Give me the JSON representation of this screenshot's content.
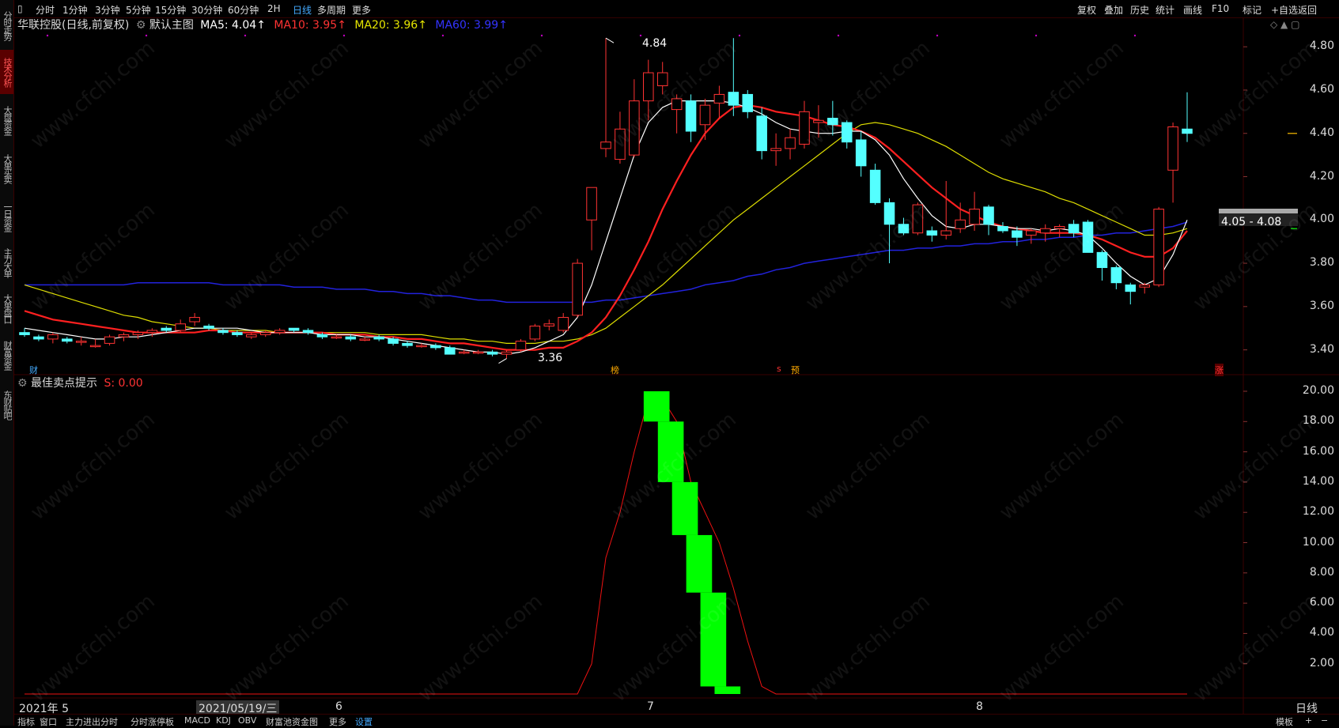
{
  "sidebar": {
    "tabs": [
      {
        "label": "分时走势",
        "active": false
      },
      {
        "label": "技术分析",
        "active": true
      },
      {
        "label": "大盘资金",
        "active": false
      },
      {
        "label": "大单买卖",
        "active": false
      },
      {
        "label": "一日资金",
        "active": false
      },
      {
        "label": "主力大单",
        "active": false
      },
      {
        "label": "大单盘口",
        "active": false
      },
      {
        "label": "财富资金",
        "active": false
      },
      {
        "label": "东财贴吧",
        "active": false
      }
    ]
  },
  "toolbar": {
    "periods": [
      "分时",
      "1分钟",
      "3分钟",
      "5分钟",
      "15分钟",
      "30分钟",
      "60分钟",
      "2H",
      "日线",
      "多周期",
      "更多"
    ],
    "active_period": "日线",
    "right_items": [
      "复权",
      "叠加",
      "历史",
      "统计",
      "画线",
      "F10",
      "标记",
      "+自选",
      "返回"
    ]
  },
  "main_header": {
    "stock": "华联控股(日线,前复权)",
    "chart_name": "默认主图",
    "ma5": "MA5: 4.04↑",
    "ma10": "MA10: 3.95↑",
    "ma20": "MA20: 3.96↑",
    "ma60": "MA60: 3.99↑"
  },
  "indicator_header": {
    "name": "最佳卖点提示",
    "value": "S: 0.00"
  },
  "price_axis": [
    "4.80",
    "4.60",
    "4.40",
    "4.20",
    "4.00",
    "3.80",
    "3.60",
    "3.40"
  ],
  "indicator_axis": [
    "20.00",
    "18.00",
    "16.00",
    "14.00",
    "12.00",
    "10.00",
    "8.00",
    "6.00",
    "4.00",
    "2.00"
  ],
  "annotations": {
    "high": "4.84",
    "low": "3.36",
    "current_range": "4.05 - 4.08",
    "marker_cai": "财",
    "marker_bang": "榜",
    "marker_s": "s",
    "marker_yu": "预",
    "marker_zhang": "涨"
  },
  "date_axis": [
    "2021年 5",
    "2021/05/19/三",
    "6",
    "7",
    "8",
    "日线"
  ],
  "bottombar": {
    "items": [
      "指标",
      "窗口",
      "主力进出分时",
      "分时涨停板",
      "MACD",
      "KDJ",
      "OBV",
      "财富池资金图",
      "更多",
      "设置"
    ],
    "active": "设置",
    "right_items": [
      "模板",
      "+",
      "−"
    ]
  },
  "watermark": "www.cfchi.com",
  "colors": {
    "up": "#ff3333",
    "down": "#54ffff",
    "ma5": "#ffffff",
    "ma10": "#ff2020",
    "ma20": "#dddd00",
    "ma60": "#2222dd",
    "signal": "#00ff00",
    "grid": "#3a0000"
  },
  "chart_data": [
    {
      "type": "candlestick",
      "title": "华联控股(日线,前复权)",
      "ylim": [
        3.3,
        4.87
      ],
      "candles": [
        [
          3.48,
          3.5,
          3.46,
          3.47
        ],
        [
          3.46,
          3.47,
          3.44,
          3.45
        ],
        [
          3.45,
          3.48,
          3.43,
          3.47
        ],
        [
          3.45,
          3.46,
          3.43,
          3.44
        ],
        [
          3.44,
          3.46,
          3.42,
          3.44
        ],
        [
          3.42,
          3.45,
          3.41,
          3.42
        ],
        [
          3.43,
          3.47,
          3.42,
          3.46
        ],
        [
          3.46,
          3.48,
          3.44,
          3.47
        ],
        [
          3.47,
          3.49,
          3.45,
          3.48
        ],
        [
          3.48,
          3.5,
          3.46,
          3.49
        ],
        [
          3.5,
          3.51,
          3.48,
          3.49
        ],
        [
          3.49,
          3.54,
          3.48,
          3.52
        ],
        [
          3.53,
          3.57,
          3.51,
          3.55
        ],
        [
          3.51,
          3.52,
          3.49,
          3.5
        ],
        [
          3.49,
          3.5,
          3.47,
          3.48
        ],
        [
          3.48,
          3.49,
          3.46,
          3.47
        ],
        [
          3.46,
          3.48,
          3.45,
          3.47
        ],
        [
          3.47,
          3.49,
          3.46,
          3.48
        ],
        [
          3.48,
          3.5,
          3.47,
          3.49
        ],
        [
          3.5,
          3.5,
          3.48,
          3.49
        ],
        [
          3.49,
          3.5,
          3.47,
          3.48
        ],
        [
          3.47,
          3.48,
          3.45,
          3.46
        ],
        [
          3.46,
          3.47,
          3.45,
          3.46
        ],
        [
          3.46,
          3.47,
          3.44,
          3.45
        ],
        [
          3.45,
          3.46,
          3.44,
          3.45
        ],
        [
          3.46,
          3.47,
          3.44,
          3.45
        ],
        [
          3.45,
          3.46,
          3.42,
          3.43
        ],
        [
          3.43,
          3.44,
          3.41,
          3.42
        ],
        [
          3.42,
          3.43,
          3.41,
          3.42
        ],
        [
          3.42,
          3.43,
          3.4,
          3.41
        ],
        [
          3.41,
          3.42,
          3.38,
          3.38
        ],
        [
          3.39,
          3.4,
          3.38,
          3.39
        ],
        [
          3.39,
          3.4,
          3.38,
          3.39
        ],
        [
          3.39,
          3.4,
          3.37,
          3.38
        ],
        [
          3.38,
          3.4,
          3.36,
          3.39
        ],
        [
          3.4,
          3.45,
          3.39,
          3.44
        ],
        [
          3.45,
          3.52,
          3.44,
          3.51
        ],
        [
          3.51,
          3.54,
          3.49,
          3.52
        ],
        [
          3.49,
          3.57,
          3.48,
          3.55
        ],
        [
          3.56,
          3.82,
          3.55,
          3.8
        ],
        [
          4.0,
          4.08,
          3.86,
          4.15
        ],
        [
          4.33,
          4.84,
          4.29,
          4.36
        ],
        [
          4.28,
          4.5,
          4.26,
          4.42
        ],
        [
          4.3,
          4.65,
          4.29,
          4.55
        ],
        [
          4.55,
          4.74,
          4.46,
          4.68
        ],
        [
          4.62,
          4.73,
          4.58,
          4.68
        ],
        [
          4.51,
          4.58,
          4.4,
          4.56
        ],
        [
          4.55,
          4.58,
          4.36,
          4.41
        ],
        [
          4.44,
          4.56,
          4.37,
          4.53
        ],
        [
          4.54,
          4.62,
          4.47,
          4.58
        ],
        [
          4.59,
          4.84,
          4.48,
          4.53
        ],
        [
          4.58,
          4.6,
          4.47,
          4.5
        ],
        [
          4.48,
          4.52,
          4.28,
          4.32
        ],
        [
          4.32,
          4.4,
          4.25,
          4.33
        ],
        [
          4.33,
          4.42,
          4.28,
          4.38
        ],
        [
          4.35,
          4.55,
          4.33,
          4.5
        ],
        [
          4.45,
          4.53,
          4.38,
          4.46
        ],
        [
          4.47,
          4.55,
          4.39,
          4.44
        ],
        [
          4.45,
          4.46,
          4.33,
          4.36
        ],
        [
          4.37,
          4.41,
          4.2,
          4.25
        ],
        [
          4.23,
          4.26,
          4.07,
          4.08
        ],
        [
          4.08,
          4.1,
          3.8,
          3.98
        ],
        [
          3.98,
          4.01,
          3.93,
          3.94
        ],
        [
          3.94,
          4.08,
          3.93,
          4.07
        ],
        [
          3.95,
          3.97,
          3.9,
          3.93
        ],
        [
          3.93,
          4.18,
          3.91,
          3.95
        ],
        [
          3.96,
          4.08,
          3.94,
          4.0
        ],
        [
          3.98,
          4.13,
          3.95,
          4.05
        ],
        [
          4.06,
          4.07,
          3.93,
          3.98
        ],
        [
          3.97,
          3.99,
          3.94,
          3.95
        ],
        [
          3.95,
          3.97,
          3.88,
          3.92
        ],
        [
          3.93,
          3.96,
          3.89,
          3.95
        ],
        [
          3.94,
          3.98,
          3.9,
          3.96
        ],
        [
          3.96,
          3.98,
          3.92,
          3.97
        ],
        [
          3.98,
          4.0,
          3.92,
          3.94
        ],
        [
          3.99,
          4.0,
          3.85,
          3.85
        ],
        [
          3.85,
          3.86,
          3.72,
          3.78
        ],
        [
          3.78,
          3.79,
          3.68,
          3.71
        ],
        [
          3.7,
          3.71,
          3.61,
          3.67
        ],
        [
          3.69,
          3.71,
          3.66,
          3.7
        ],
        [
          3.7,
          4.06,
          3.69,
          4.05
        ],
        [
          4.23,
          4.45,
          4.08,
          4.43
        ],
        [
          4.42,
          4.59,
          4.36,
          4.4
        ]
      ],
      "ma": [
        {
          "name": "MA5",
          "values": [
            3.5,
            3.49,
            3.48,
            3.47,
            3.46,
            3.45,
            3.45,
            3.46,
            3.46,
            3.47,
            3.48,
            3.49,
            3.5,
            3.5,
            3.5,
            3.5,
            3.49,
            3.48,
            3.48,
            3.48,
            3.48,
            3.47,
            3.47,
            3.47,
            3.46,
            3.46,
            3.45,
            3.44,
            3.43,
            3.42,
            3.41,
            3.4,
            3.39,
            3.39,
            3.38,
            3.39,
            3.41,
            3.44,
            3.47,
            3.55,
            3.7,
            3.9,
            4.1,
            4.3,
            4.45,
            4.52,
            4.55,
            4.55,
            4.55,
            4.55,
            4.54,
            4.52,
            4.49,
            4.45,
            4.42,
            4.41,
            4.4,
            4.4,
            4.41,
            4.41,
            4.37,
            4.3,
            4.19,
            4.1,
            4.02,
            3.97,
            3.96,
            3.98,
            3.98,
            3.97,
            3.96,
            3.96,
            3.95,
            3.96,
            3.95,
            3.93,
            3.87,
            3.8,
            3.74,
            3.7,
            3.73,
            3.84,
            4.0
          ]
        },
        {
          "name": "MA10",
          "values": [
            3.58,
            3.56,
            3.54,
            3.53,
            3.52,
            3.51,
            3.5,
            3.49,
            3.48,
            3.48,
            3.48,
            3.48,
            3.48,
            3.49,
            3.49,
            3.48,
            3.48,
            3.48,
            3.48,
            3.48,
            3.48,
            3.48,
            3.47,
            3.47,
            3.47,
            3.46,
            3.46,
            3.45,
            3.45,
            3.44,
            3.43,
            3.43,
            3.42,
            3.41,
            3.4,
            3.4,
            3.4,
            3.41,
            3.41,
            3.44,
            3.48,
            3.55,
            3.65,
            3.77,
            3.9,
            4.05,
            4.18,
            4.3,
            4.4,
            4.47,
            4.52,
            4.53,
            4.52,
            4.5,
            4.49,
            4.48,
            4.46,
            4.44,
            4.43,
            4.41,
            4.38,
            4.33,
            4.27,
            4.21,
            4.15,
            4.1,
            4.05,
            4.02,
            3.99,
            3.97,
            3.96,
            3.95,
            3.94,
            3.94,
            3.94,
            3.93,
            3.91,
            3.88,
            3.85,
            3.83,
            3.83,
            3.87,
            3.95
          ]
        },
        {
          "name": "MA20",
          "values": [
            3.7,
            3.68,
            3.66,
            3.64,
            3.62,
            3.6,
            3.58,
            3.56,
            3.55,
            3.53,
            3.52,
            3.51,
            3.5,
            3.5,
            3.49,
            3.49,
            3.49,
            3.49,
            3.48,
            3.48,
            3.48,
            3.48,
            3.48,
            3.48,
            3.48,
            3.47,
            3.47,
            3.47,
            3.47,
            3.46,
            3.45,
            3.45,
            3.44,
            3.44,
            3.43,
            3.43,
            3.43,
            3.44,
            3.44,
            3.45,
            3.47,
            3.5,
            3.55,
            3.6,
            3.65,
            3.7,
            3.76,
            3.82,
            3.88,
            3.94,
            4.0,
            4.05,
            4.1,
            4.15,
            4.2,
            4.25,
            4.3,
            4.35,
            4.4,
            4.44,
            4.45,
            4.44,
            4.42,
            4.4,
            4.37,
            4.34,
            4.3,
            4.26,
            4.22,
            4.19,
            4.17,
            4.15,
            4.13,
            4.1,
            4.08,
            4.05,
            4.02,
            3.99,
            3.96,
            3.93,
            3.93,
            3.94,
            3.96
          ]
        },
        {
          "name": "MA60",
          "values": [
            3.7,
            3.7,
            3.7,
            3.7,
            3.7,
            3.7,
            3.7,
            3.7,
            3.71,
            3.71,
            3.71,
            3.71,
            3.71,
            3.71,
            3.7,
            3.7,
            3.7,
            3.7,
            3.7,
            3.69,
            3.69,
            3.69,
            3.68,
            3.68,
            3.68,
            3.67,
            3.67,
            3.66,
            3.66,
            3.65,
            3.65,
            3.64,
            3.63,
            3.63,
            3.62,
            3.62,
            3.62,
            3.62,
            3.62,
            3.62,
            3.62,
            3.63,
            3.63,
            3.64,
            3.65,
            3.66,
            3.67,
            3.68,
            3.7,
            3.71,
            3.72,
            3.74,
            3.75,
            3.77,
            3.78,
            3.8,
            3.81,
            3.82,
            3.83,
            3.84,
            3.85,
            3.86,
            3.86,
            3.87,
            3.87,
            3.88,
            3.88,
            3.89,
            3.89,
            3.9,
            3.9,
            3.91,
            3.91,
            3.92,
            3.92,
            3.93,
            3.93,
            3.94,
            3.94,
            3.95,
            3.96,
            3.97,
            3.99
          ]
        }
      ]
    },
    {
      "type": "line",
      "title": "最佳卖点提示",
      "ylim": [
        0,
        20
      ],
      "series": [
        {
          "name": "S",
          "values": [
            0,
            0,
            0,
            0,
            0,
            0,
            0,
            0,
            0,
            0,
            0,
            0,
            0,
            0,
            0,
            0,
            0,
            0,
            0,
            0,
            0,
            0,
            0,
            0,
            0,
            0,
            0,
            0,
            0,
            0,
            0,
            0,
            0,
            0,
            0,
            0,
            0,
            0,
            0,
            0,
            2,
            9,
            12,
            16,
            19.5,
            19.5,
            18,
            14,
            12,
            10,
            7,
            3.5,
            0.5,
            0,
            0,
            0,
            0,
            0,
            0,
            0,
            0,
            0,
            0,
            0,
            0,
            0,
            0,
            0,
            0,
            0,
            0,
            0,
            0,
            0,
            0,
            0,
            0,
            0,
            0,
            0,
            0,
            0,
            0
          ]
        }
      ],
      "signal_bars": [
        {
          "index": 45,
          "top": 20,
          "bottom": 18
        },
        {
          "index": 46,
          "top": 18,
          "bottom": 14
        },
        {
          "index": 47,
          "top": 14,
          "bottom": 10.5
        },
        {
          "index": 48,
          "top": 10.5,
          "bottom": 6.7
        },
        {
          "index": 49,
          "top": 6.7,
          "bottom": 0.5
        },
        {
          "index": 50,
          "top": 0.5,
          "bottom": 0
        }
      ]
    }
  ]
}
